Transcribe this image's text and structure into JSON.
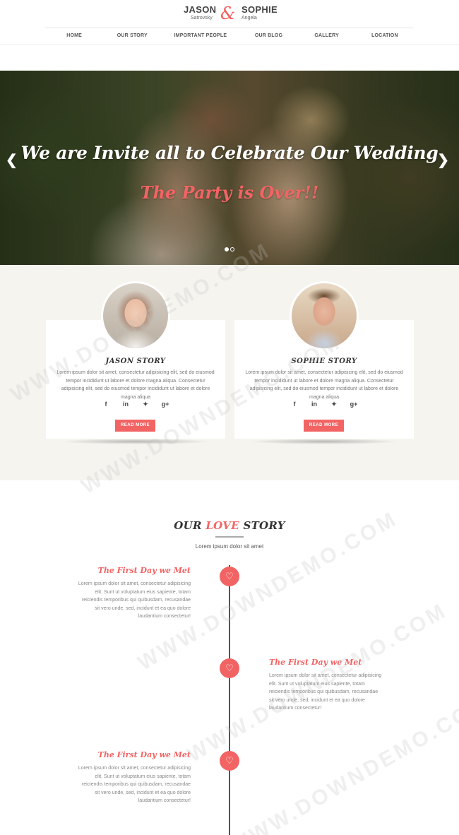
{
  "header": {
    "groom_name": "JASON",
    "groom_surname": "Satrovsky",
    "ampersand": "&",
    "bride_name": "SOPHIE",
    "bride_surname": "Angela",
    "nav": [
      "HOME",
      "OUR STORY",
      "IMPORTANT PEOPLE",
      "OUR BLOG",
      "GALLERY",
      "LOCATION"
    ]
  },
  "hero": {
    "title": "We are Invite all to Celebrate Our Wedding",
    "subtitle": "The Party is Over!!",
    "prev_icon": "chevron-left-icon",
    "next_icon": "chevron-right-icon",
    "slides": 2,
    "active_slide": 1
  },
  "stories": [
    {
      "title": "JASON STORY",
      "text": "Lorem ipsum dolor sit amet, consectetur adipisicing elit, sed do eiusmod tempor incididunt ut labore et dolore magna aliqua. Consectetur adipisicing elit, sed do eiusmod tempor incididunt ut labore et dolore magna aliqua",
      "socials": [
        "f",
        "in",
        "✓",
        "g+"
      ],
      "button": "READ MORE"
    },
    {
      "title": "SOPHIE STORY",
      "text": "Lorem ipsum dolor sit amet, consectetur adipisicing elit, sed do eiusmod tempor incididunt ut labore et dolore magna aliqua. Consectetur adipisicing elit, sed do eiusmod tempor incididunt ut labore et dolore magna aliqua",
      "socials": [
        "f",
        "in",
        "✓",
        "g+"
      ],
      "button": "READ MORE"
    }
  ],
  "love": {
    "title_pre": "OUR ",
    "title_accent": "LOVE",
    "title_post": " STORY",
    "subtitle": "Lorem ipsum dolor sit amet",
    "events": [
      {
        "title": "The First Day we Met",
        "text": "Lorem ipsum dolor sit amet, consectetur adipisicing elit. Sunt ut voluptatum eius sapiente, totam reiciendis temporibus qui quibusdam, recusandae sit vero unde, sed, incidunt et ea quo dolore laudantium consectetur!"
      },
      {
        "title": "The First Day we Met",
        "text": "Lorem ipsum dolor sit amet, consectetur adipisicing elit. Sunt ut voluptatum eius sapiente, totam reiciendis temporibus qui quibusdam, recusandae sit vero unde, sed, incidunt et ea quo dolore laudantium consectetur!"
      },
      {
        "title": "The First Day we Met",
        "text": "Lorem ipsum dolor sit amet, consectetur adipisicing elit. Sunt ut voluptatum eius sapiente, totam reiciendis temporibus qui quibusdam, recusandae sit vero unde, sed, incidunt et ea quo dolore laudantium consectetur!"
      }
    ],
    "heart_icon": "heart-icon"
  },
  "watermark": "WWW.DOWNDEMO.COM",
  "colors": {
    "accent": "#f26464",
    "section_bg": "#f5f4ef",
    "text": "#333333"
  }
}
